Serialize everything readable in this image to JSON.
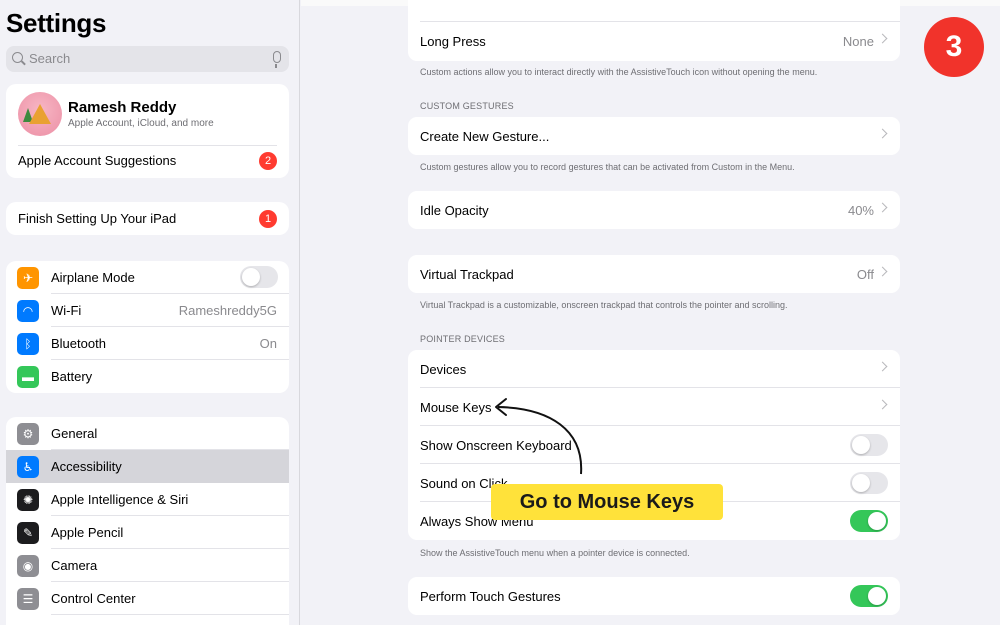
{
  "sidebar": {
    "title": "Settings",
    "search_placeholder": "Search",
    "profile": {
      "name": "Ramesh Reddy",
      "subtitle": "Apple Account, iCloud, and more",
      "suggestions_label": "Apple Account Suggestions",
      "suggestions_badge": "2"
    },
    "finish": {
      "label": "Finish Setting Up Your iPad",
      "badge": "1"
    },
    "group1": [
      {
        "label": "Airplane Mode",
        "icon": "airplane-icon",
        "color": "#ff9500",
        "toggle": false
      },
      {
        "label": "Wi-Fi",
        "icon": "wifi-icon",
        "color": "#007aff",
        "value": "Rameshreddy5G"
      },
      {
        "label": "Bluetooth",
        "icon": "bluetooth-icon",
        "color": "#007aff",
        "value": "On"
      },
      {
        "label": "Battery",
        "icon": "battery-icon",
        "color": "#34c759"
      }
    ],
    "group2": [
      {
        "label": "General",
        "icon": "gear-icon",
        "color": "#8e8e93"
      },
      {
        "label": "Accessibility",
        "icon": "accessibility-icon",
        "color": "#007aff",
        "selected": true
      },
      {
        "label": "Apple Intelligence & Siri",
        "icon": "siri-icon",
        "color": "#1c1c1e"
      },
      {
        "label": "Apple Pencil",
        "icon": "pencil-icon",
        "color": "#1c1c1e"
      },
      {
        "label": "Camera",
        "icon": "camera-icon",
        "color": "#8e8e93"
      },
      {
        "label": "Control Center",
        "icon": "control-center-icon",
        "color": "#8e8e93"
      }
    ]
  },
  "detail": {
    "long_press": {
      "label": "Long Press",
      "value": "None"
    },
    "custom_actions_footer": "Custom actions allow you to interact directly with the AssistiveTouch icon without opening the menu.",
    "custom_gestures_header": "CUSTOM GESTURES",
    "create_gesture": {
      "label": "Create New Gesture..."
    },
    "custom_gestures_footer": "Custom gestures allow you to record gestures that can be activated from Custom in the Menu.",
    "idle_opacity": {
      "label": "Idle Opacity",
      "value": "40%"
    },
    "virtual_trackpad": {
      "label": "Virtual Trackpad",
      "value": "Off"
    },
    "virtual_trackpad_footer": "Virtual Trackpad is a customizable, onscreen trackpad that controls the pointer and scrolling.",
    "pointer_devices_header": "POINTER DEVICES",
    "devices": {
      "label": "Devices"
    },
    "mouse_keys": {
      "label": "Mouse Keys"
    },
    "show_keyboard": {
      "label": "Show Onscreen Keyboard",
      "on": false
    },
    "sound_on_click": {
      "label": "Sound on Click",
      "on": false
    },
    "always_show_menu": {
      "label": "Always Show Menu",
      "on": true
    },
    "pointer_footer": "Show the AssistiveTouch menu when a pointer device is connected.",
    "perform_touch": {
      "label": "Perform Touch Gestures",
      "on": true
    }
  },
  "overlay": {
    "step_number": "3",
    "callout_text": "Go to Mouse Keys",
    "step_color": "#f1332b",
    "callout_color": "#ffe23a"
  }
}
